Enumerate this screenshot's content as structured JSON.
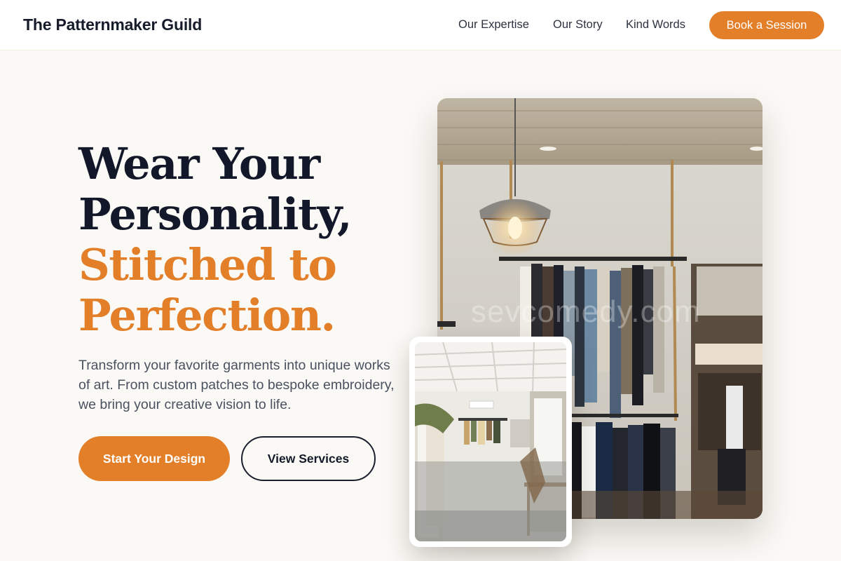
{
  "header": {
    "brand": "The Patternmaker Guild",
    "nav": [
      {
        "label": "Our Expertise"
      },
      {
        "label": "Our Story"
      },
      {
        "label": "Kind Words"
      }
    ],
    "cta_label": "Book a Session"
  },
  "hero": {
    "headline_line1": "Wear Your",
    "headline_line2": "Personality,",
    "headline_accent_line1": "Stitched to",
    "headline_accent_line2": "Perfection.",
    "description": "Transform your favorite garments into unique works of art. From custom patches to bespoke embroidery, we bring your creative vision to life.",
    "primary_cta": "Start Your Design",
    "secondary_cta": "View Services"
  },
  "images": {
    "watermark": "sevcomedy.com"
  },
  "colors": {
    "accent": "#e27f28",
    "ink": "#121829",
    "background": "#faf9f5"
  }
}
